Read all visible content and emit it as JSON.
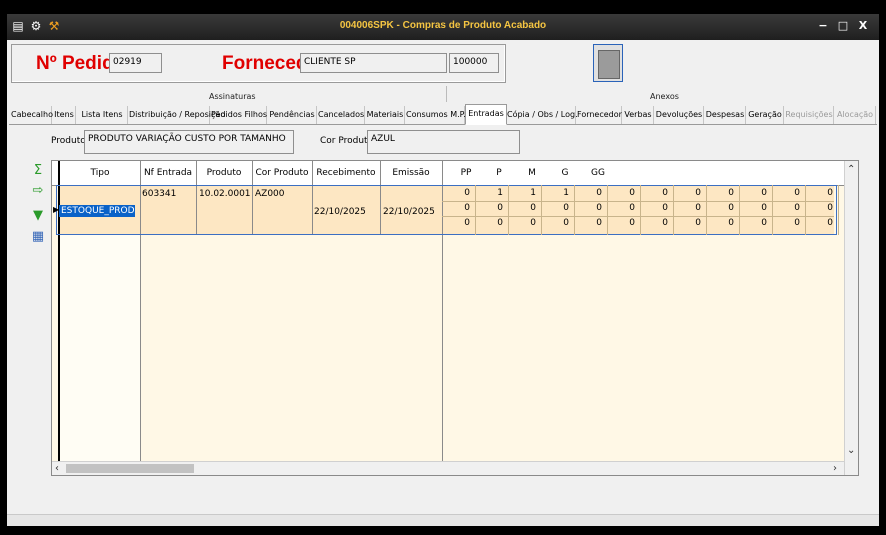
{
  "window": {
    "title": "004006SPK - Compras de Produto Acabado",
    "min_glyph": "−",
    "max_glyph": "□",
    "close_glyph": "X"
  },
  "header": {
    "pedido_label": "Nº Pedido",
    "pedido_value": "02919",
    "fornecedor_label": "Fornecedor",
    "fornecedor_name": "CLIENTE SP",
    "fornecedor_code": "100000"
  },
  "sections": {
    "assinaturas": "Assinaturas",
    "anexos": "Anexos"
  },
  "tabs": [
    {
      "label": "Cabecalho",
      "active": false,
      "disabled": false
    },
    {
      "label": "Itens",
      "active": false,
      "disabled": false
    },
    {
      "label": "Lista Itens",
      "active": false,
      "disabled": false
    },
    {
      "label": "Distribuição / Reposição",
      "active": false,
      "disabled": false
    },
    {
      "label": "Pedidos Filhos",
      "active": false,
      "disabled": false
    },
    {
      "label": "Pendências",
      "active": false,
      "disabled": false
    },
    {
      "label": "Cancelados",
      "active": false,
      "disabled": false
    },
    {
      "label": "Materiais",
      "active": false,
      "disabled": false
    },
    {
      "label": "Consumos M.P.",
      "active": false,
      "disabled": false
    },
    {
      "label": "Entradas",
      "active": true,
      "disabled": false
    },
    {
      "label": "Cópia / Obs / Log.",
      "active": false,
      "disabled": false
    },
    {
      "label": "Fornecedor",
      "active": false,
      "disabled": false
    },
    {
      "label": "Verbas",
      "active": false,
      "disabled": false
    },
    {
      "label": "Devoluções",
      "active": false,
      "disabled": false
    },
    {
      "label": "Despesas",
      "active": false,
      "disabled": false
    },
    {
      "label": "Geração",
      "active": false,
      "disabled": false
    },
    {
      "label": "Requisições",
      "active": false,
      "disabled": true
    },
    {
      "label": "Alocação",
      "active": false,
      "disabled": true
    }
  ],
  "filters": {
    "produto_label": "Produto",
    "produto_value": "PRODUTO VARIAÇÃO CUSTO POR TAMANHO",
    "cor_label": "Cor Produto",
    "cor_value": "AZUL"
  },
  "side_icons": [
    "sum-icon",
    "export-icon",
    "download-arrow-icon",
    "image-icon"
  ],
  "grid": {
    "columns": [
      "Tipo",
      "Nf Entrada",
      "Produto",
      "Cor Produto",
      "Recebimento",
      "Emissão"
    ],
    "size_columns": [
      "PP",
      "P",
      "M",
      "G",
      "GG"
    ],
    "row": {
      "tipo": "ESTOQUE_PROD",
      "nf_entrada": "603341",
      "produto": "10.02.0001",
      "cor": "AZ000",
      "recebimento": "22/10/2025",
      "emissao": "22/10/2025"
    },
    "qty_rows": [
      [
        "0",
        "1",
        "1",
        "1",
        "0",
        "0",
        "0",
        "0",
        "0",
        "0",
        "0",
        "0"
      ],
      [
        "0",
        "0",
        "0",
        "0",
        "0",
        "0",
        "0",
        "0",
        "0",
        "0",
        "0",
        "0"
      ],
      [
        "0",
        "0",
        "0",
        "0",
        "0",
        "0",
        "0",
        "0",
        "0",
        "0",
        "0",
        "0"
      ]
    ]
  },
  "colors": {
    "title": "#f5c542",
    "accent_red": "#e00000",
    "grid_bg": "#fff8e6",
    "row_bg": "#fde7c3",
    "selection": "#0a62c8"
  }
}
